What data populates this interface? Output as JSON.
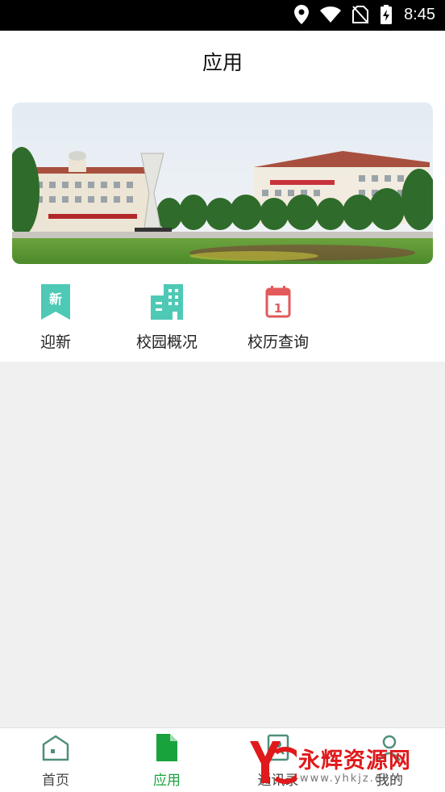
{
  "status_bar": {
    "time": "8:45"
  },
  "header": {
    "title": "应用"
  },
  "apps": [
    {
      "label": "迎新",
      "icon": "new-ribbon-icon",
      "badge": "新",
      "color": "#4ec9b5"
    },
    {
      "label": "校园概况",
      "icon": "buildings-icon",
      "color": "#4ec9b5"
    },
    {
      "label": "校历查询",
      "icon": "calendar-icon",
      "badge": "1",
      "color": "#e25a5a"
    }
  ],
  "bottom_nav": [
    {
      "label": "首页",
      "icon": "home-icon"
    },
    {
      "label": "应用",
      "icon": "document-icon",
      "active": true
    },
    {
      "label": "通讯录",
      "icon": "contacts-icon"
    },
    {
      "label": "我的",
      "icon": "user-icon"
    }
  ],
  "watermark": {
    "text": "永辉资源网",
    "url": "www.yhkjz.com"
  },
  "colors": {
    "accent": "#19a33d",
    "teal": "#4ec9b5",
    "red": "#e25a5a",
    "watermark": "#e0191b"
  }
}
